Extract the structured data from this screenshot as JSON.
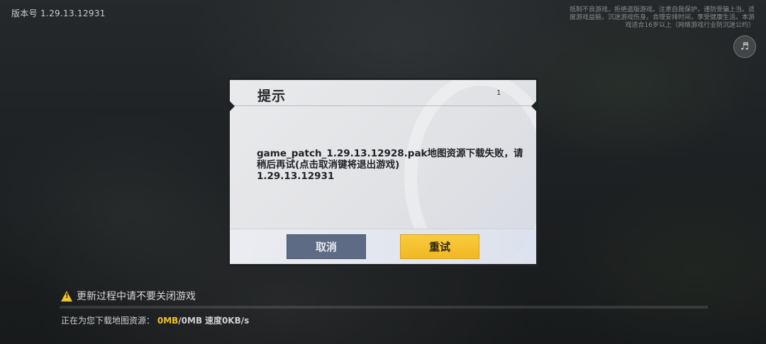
{
  "top": {
    "version_label": "版本号 1.29.13.12931",
    "notice_text": "抵制不良游戏，拒绝盗版游戏。注意自我保护，谨防受骗上当。适度游戏益脑，沉迷游戏伤身。合理安排时间，享受健康生活。本游戏适合16岁以上（网络游戏行业防沉迷公约）",
    "speaker_icon": "speaker-icon"
  },
  "dialog": {
    "title": "提示",
    "counter": "1",
    "message_line1": "game_patch_1.29.13.12928.pak地图资源下载失败，请",
    "message_line2": "稍后再试(点击取消键将退出游戏)",
    "message_line3": "1.29.13.12931",
    "cancel_label": "取消",
    "retry_label": "重试"
  },
  "status": {
    "warning_text": "更新过程中请不要关闭游戏",
    "progress_fraction": 0,
    "download_prefix": "正在为您下载地图资源：",
    "downloaded": "0MB",
    "total": "/0MB",
    "speed": "速度0KB/s"
  },
  "colors": {
    "accent_yellow": "#f1c32a",
    "cancel_button": "#5e6b85",
    "dialog_bg": "#e5e6e9"
  }
}
